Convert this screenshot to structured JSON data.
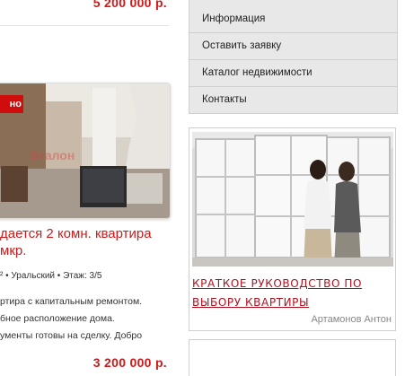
{
  "listings": {
    "previous_price": "5 200 000 р.",
    "badge": "но",
    "title_line1": "дается 2 комн. квартира",
    "title_line2": "мкр.",
    "meta": "² • Уральский • Этаж: 3/5",
    "desc_lines": [
      "ртира с капитальным ремонтом.",
      "бное расположение дома.",
      "ументы готовы на сделку. Добро"
    ],
    "price": "3 200 000 р.",
    "accent_color": "#cc1a1a"
  },
  "menu": {
    "items": [
      {
        "label": "Информация"
      },
      {
        "label": "Оставить заявку"
      },
      {
        "label": "Каталог недвижимости"
      },
      {
        "label": "Контакты"
      }
    ]
  },
  "article": {
    "title": "Краткое руководство по выбору квартиры",
    "author": "Артамонов Антон",
    "link_color": "#b0111e"
  }
}
